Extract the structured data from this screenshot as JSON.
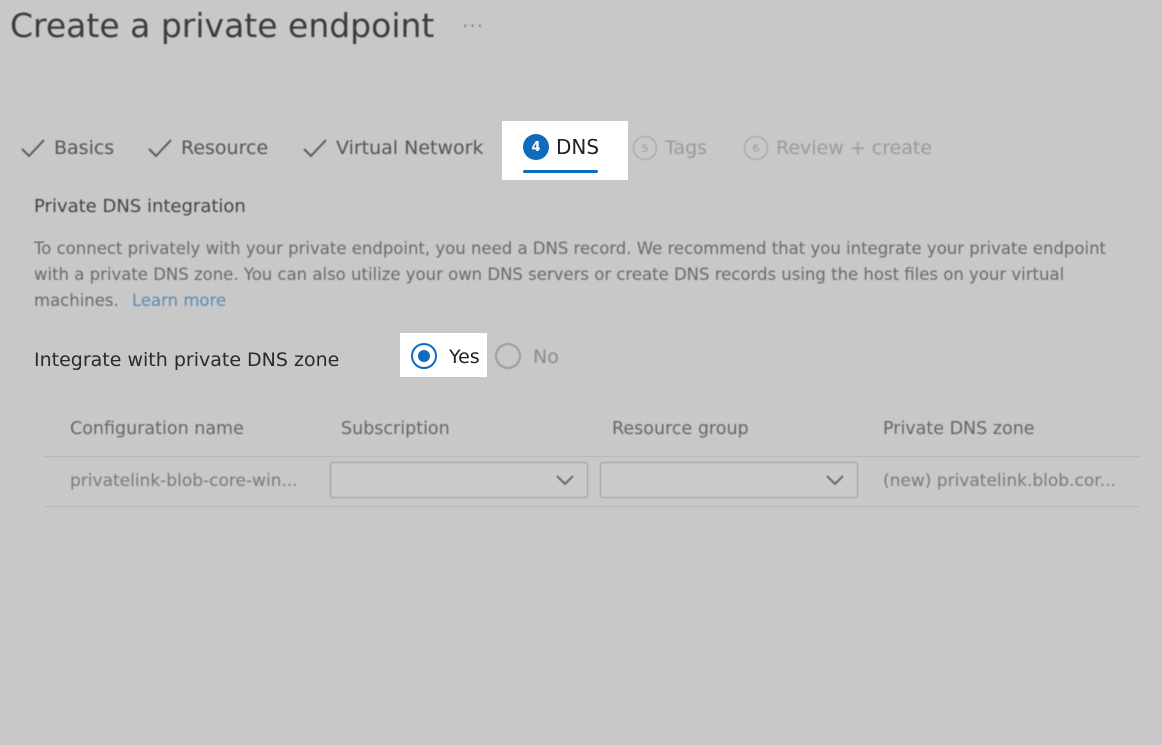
{
  "page": {
    "title": "Create a private endpoint",
    "more": "···"
  },
  "steps": [
    {
      "label": "Basics",
      "state": "done"
    },
    {
      "label": "Resource",
      "state": "done"
    },
    {
      "label": "Virtual Network",
      "state": "done"
    },
    {
      "number": "4",
      "label": "DNS",
      "state": "active"
    },
    {
      "number": "5",
      "label": "Tags",
      "state": "upcoming"
    },
    {
      "number": "6",
      "label": "Review + create",
      "state": "upcoming"
    }
  ],
  "section": {
    "title": "Private DNS integration",
    "description": "To connect privately with your private endpoint, you need a DNS record. We recommend that you integrate your private endpoint with a private DNS zone. You can also utilize your own DNS servers or create DNS records using the host files on your virtual machines.",
    "learn_more": "Learn more"
  },
  "integrate": {
    "label": "Integrate with private DNS zone",
    "options": {
      "yes": "Yes",
      "no": "No"
    },
    "selected": "Yes"
  },
  "table": {
    "headers": [
      "Configuration name",
      "Subscription",
      "Resource group",
      "Private DNS zone"
    ],
    "row": {
      "configuration_name": "privatelink-blob-core-win...",
      "subscription": "",
      "resource_group": "",
      "private_dns_zone": "(new) privatelink.blob.cor..."
    }
  },
  "colors": {
    "accent": "#0f6cbd",
    "overlay": "#c8c8c8",
    "highlight": "#ffffff"
  }
}
